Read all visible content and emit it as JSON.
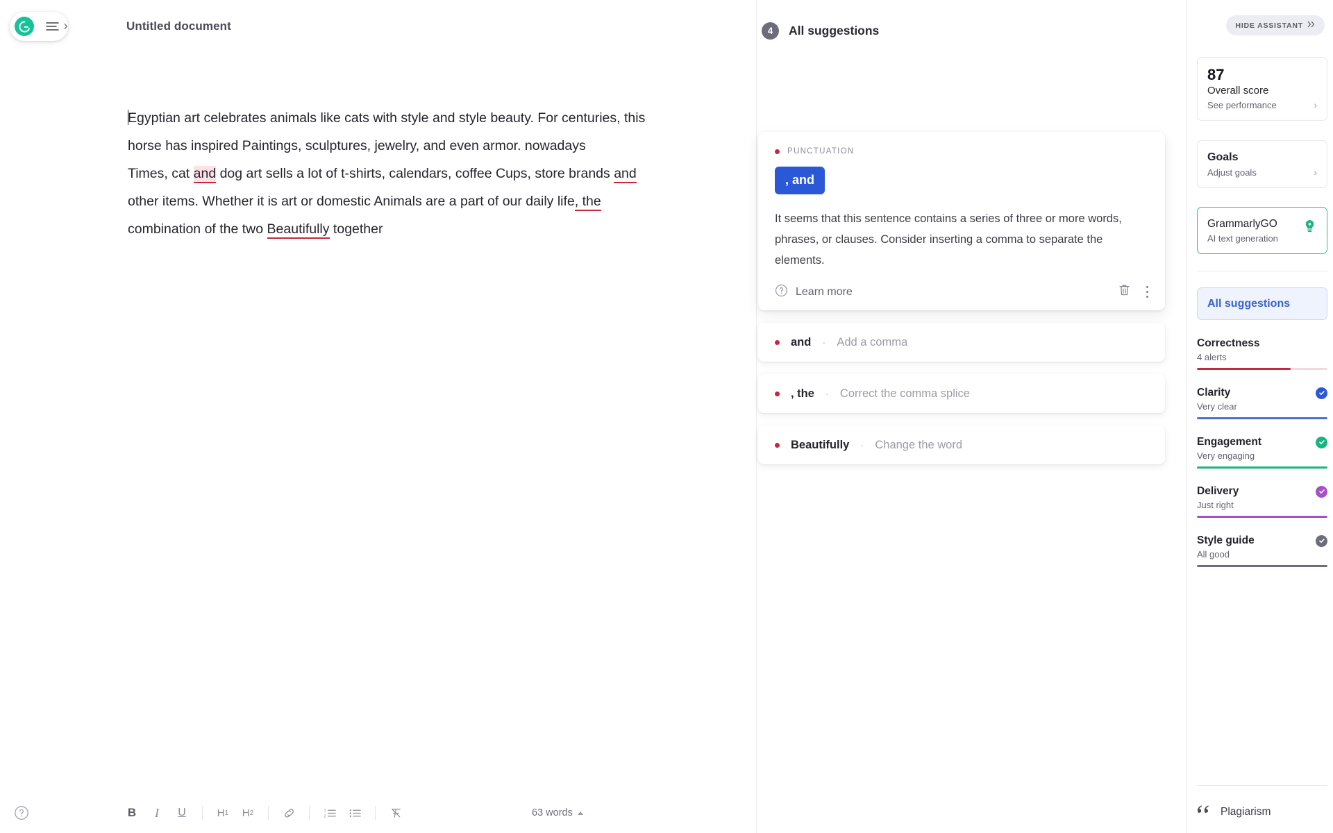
{
  "brand": {
    "logo_icon": "grammarly-logo-icon",
    "menu_icon": "hamburger-menu-icon"
  },
  "document": {
    "title": "Untitled document",
    "lines": [
      "Egyptian art celebrates animals like cats with style and style beauty. For centuries, this horse has inspired Paintings, sculptures, jewelry, and even armor. nowadays",
      "Times, cat and dog art sells a lot of t-shirts, calendars, coffee Cups, store brands and other items. Whether it is art or domestic Animals are a part of our daily life, the combination of the two Beautifully together"
    ],
    "para1_a": "Egyptian art celebrates animals like cats with style and style beauty. For centuries, this horse has inspired Paintings, sculptures, jewelry, and even armor. nowadays",
    "para2_a": "Times, cat ",
    "para2_hl": "and",
    "para2_b": " dog art sells a lot of t-shirts, calendars, coffee Cups, store brands ",
    "para2_ul1": "and",
    "para2_c": " other items. Whether it is art or domestic Animals are a part of our daily life",
    "para2_ul2": ", the",
    "para2_d": " combination of the two ",
    "para2_ul3": "Beautifully",
    "para2_e": " together"
  },
  "toolbar": {
    "help_icon": "help-circle-icon",
    "bold_label": "B",
    "italic_label": "I",
    "underline_label": "U",
    "h1_label": "H",
    "h1_sub": "1",
    "h2_label": "H",
    "h2_sub": "2",
    "link_icon": "link-icon",
    "ordered_list_icon": "numbered-list-icon",
    "bullet_list_icon": "bullet-list-icon",
    "clear_format_icon": "clear-formatting-icon",
    "word_count": "63 words"
  },
  "suggestions_panel": {
    "count": "4",
    "header": "All suggestions",
    "main_card": {
      "category": "PUNCTUATION",
      "replacement": ", and",
      "explanation": "It seems that this sentence contains a series of three or more words, phrases, or clauses. Consider inserting a comma to separate the elements.",
      "learn_more": "Learn more",
      "help_icon": "help-circle-icon",
      "delete_icon": "trash-icon",
      "more_icon": "more-vertical-icon"
    },
    "mini_cards": [
      {
        "word": "and",
        "separator": "·",
        "action": "Add a comma"
      },
      {
        "word": ", the",
        "separator": "·",
        "action": "Correct the comma splice"
      },
      {
        "word": "Beautifully",
        "separator": "·",
        "action": "Change the word"
      }
    ]
  },
  "assistant": {
    "hide_label": "HIDE ASSISTANT",
    "hide_icon": "double-chevron-right-icon",
    "score": {
      "value": "87",
      "title": "Overall score",
      "sub": "See performance",
      "chevron": "›"
    },
    "goals": {
      "title": "Goals",
      "sub": "Adjust goals",
      "chevron": "›"
    },
    "grammarly_go": {
      "title": "GrammarlyGO",
      "sub": "AI text generation",
      "icon": "lightbulb-icon",
      "border_color": "#28c09a"
    },
    "all_suggestions_tab": "All suggestions",
    "metrics": [
      {
        "name": "Correctness",
        "sub": "4 alerts",
        "color": "#c5283f",
        "fill": 72,
        "check": false
      },
      {
        "name": "Clarity",
        "sub": "Very clear",
        "color": "#4c6fd0",
        "fill": 100,
        "check": true
      },
      {
        "name": "Engagement",
        "sub": "Very engaging",
        "color": "#16b681",
        "fill": 100,
        "check": true
      },
      {
        "name": "Delivery",
        "sub": "Just right",
        "color": "#a94ec4",
        "fill": 100,
        "check": true
      },
      {
        "name": "Style guide",
        "sub": "All good",
        "color": "#6c6c7d",
        "fill": 100,
        "check": true
      }
    ],
    "plagiarism": {
      "label": "Plagiarism",
      "icon": "quote-icon"
    }
  }
}
